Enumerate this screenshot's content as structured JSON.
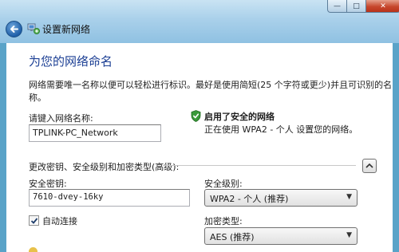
{
  "window": {
    "title": "设置新网络",
    "controls": {
      "minimize": "—",
      "maximize": "□",
      "close": "✕"
    },
    "icons": {
      "back": "back-arrow-icon",
      "network": "network-icon"
    }
  },
  "page": {
    "heading": "为您的网络命名",
    "description": "网络需要唯一名称以便可以轻松进行标识。最好是使用简短(25 个字符或更少)并且可识别的名称。"
  },
  "network_name": {
    "label": "请键入网络名称:",
    "value": "TPLINK-PC_Network"
  },
  "security_status": {
    "title": "启用了安全的网络",
    "description": "正在使用 WPA2 - 个人 设置您的网络。",
    "icon": "green-shield-check-icon",
    "color": "#3a9a3a"
  },
  "advanced": {
    "label": "更改密钥、安全级别和加密类型(高级):",
    "security_key_label": "安全密钥:",
    "security_key_value": "7610-dvey-16ky",
    "security_level_label": "安全级别:",
    "security_level_value": "WPA2 - 个人 (推荐)",
    "auto_connect_label": "自动连接",
    "auto_connect_checked": true,
    "encryption_label": "加密类型:",
    "encryption_value": "AES (推荐)"
  },
  "colors": {
    "heading": "#1c3f94",
    "titlebar": "#a9d0ea",
    "close_button": "#c7472d"
  }
}
